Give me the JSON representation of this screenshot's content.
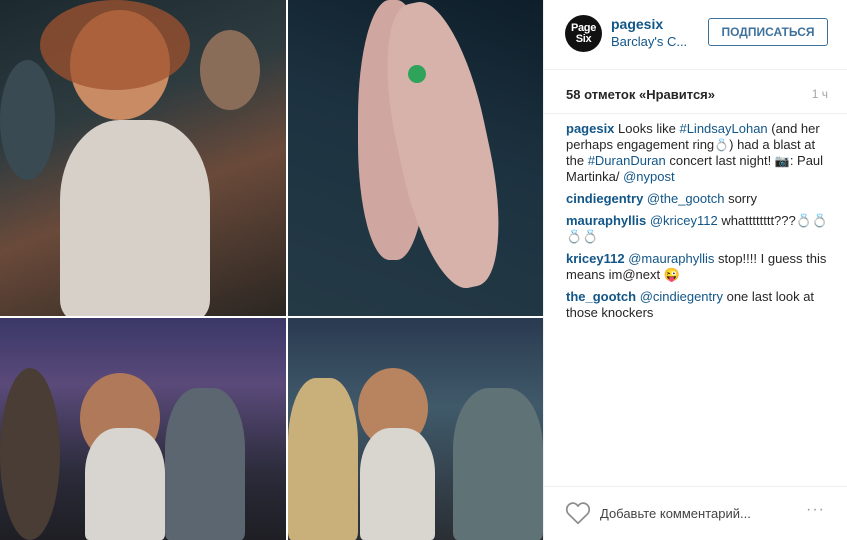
{
  "post": {
    "account": {
      "avatar_text": "Page Six",
      "username": "pagesix",
      "location": "Barclay's C..."
    },
    "follow_label": "ПОДПИСАТЬСЯ",
    "likes_text": "58 отметок «Нравится»",
    "time_ago": "1 ч",
    "caption": {
      "user": "pagesix",
      "t1": " Looks like ",
      "tag1": "#LindsayLohan",
      "t2": " (and her perhaps engagement ring",
      "emoji_ring": "💍",
      "t3": ") had a blast at the ",
      "tag2": "#DuranDuran",
      "t4": " concert last night! ",
      "emoji_camera": "📷",
      "t5": ": Paul Martinka/ ",
      "mention": "@nypost"
    },
    "comments": [
      {
        "user": "cindiegentry",
        "mention": "@the_gootch",
        "text": " sorry"
      },
      {
        "user": "mauraphyllis",
        "mention": "@kricey112",
        "text": " whatttttttt???💍💍💍💍"
      },
      {
        "user": "kricey112",
        "mention": "@mauraphyllis",
        "text": " stop!!!! I guess this means im@next 😜"
      },
      {
        "user": "the_gootch",
        "mention": "@cindiegentry",
        "text": " one last look at those knockers"
      }
    ],
    "add_comment_placeholder": "Добавьте комментарий...",
    "more_label": "···"
  },
  "colors": {
    "link": "#125688",
    "follow_border": "#3f729b",
    "muted": "#a5a7aa"
  },
  "icons": {
    "like": "heart-icon",
    "more": "more-options-icon"
  }
}
